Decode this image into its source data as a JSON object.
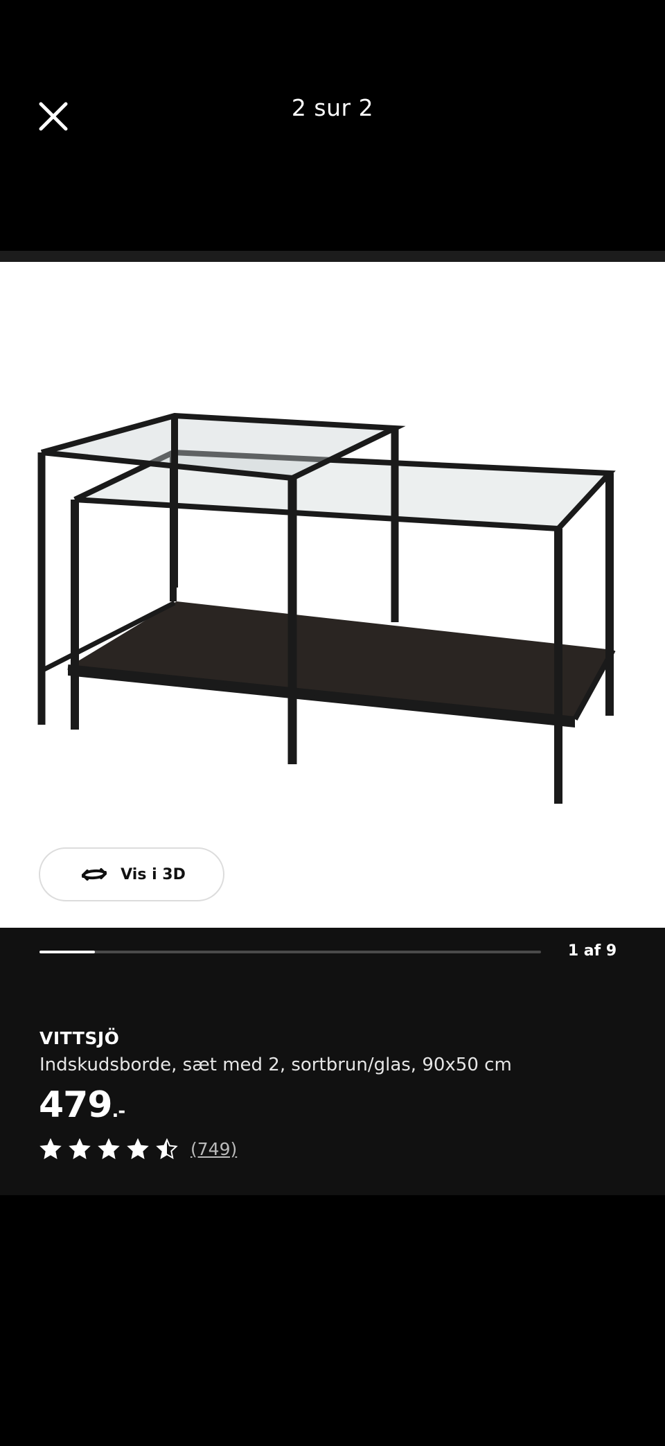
{
  "viewer": {
    "counter": "2 sur 2",
    "close_icon": "close-icon"
  },
  "gallery": {
    "view3d_label": "Vis i 3D",
    "view3d_icon": "rotate-3d-icon",
    "slide_count": "1 af 9",
    "progress": 0.11
  },
  "product": {
    "name": "VITTSJÖ",
    "description": "Indskudsborde, sæt med 2, sortbrun/glas, 90x50 cm",
    "price": "479",
    "price_suffix": ".-",
    "rating": 4.5,
    "review_count": "(749)"
  },
  "colors": {
    "background": "#000000",
    "panel": "#111111",
    "frame": "#1a1a1a",
    "shelf": "#2a2522"
  }
}
